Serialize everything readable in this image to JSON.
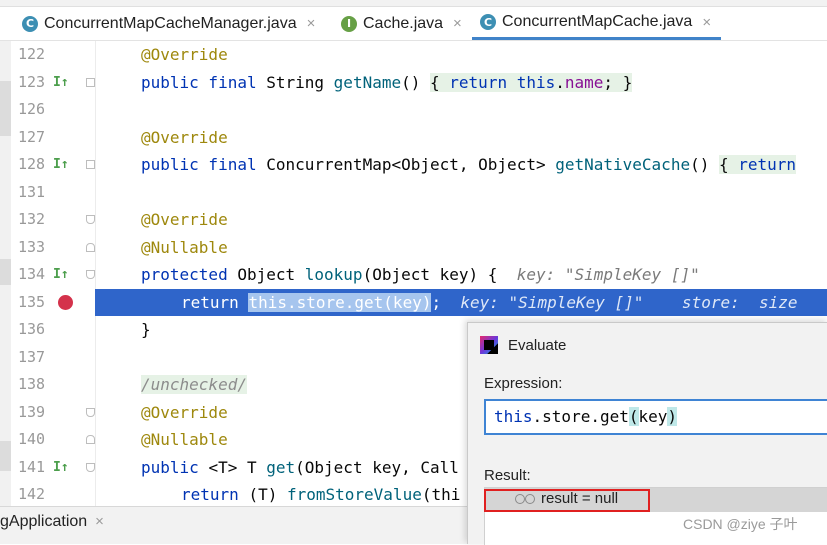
{
  "tabs": [
    {
      "label": "ConcurrentMapCacheManager.java",
      "icon": "C",
      "close": "×"
    },
    {
      "label": "Cache.java",
      "icon": "I",
      "close": "×"
    },
    {
      "label": "ConcurrentMapCache.java",
      "icon": "C",
      "close": "×",
      "active": true
    }
  ],
  "lines": {
    "l122": {
      "num": "122",
      "t1": "@Override"
    },
    "l123": {
      "num": "123",
      "t1": "public final ",
      "t2": "String ",
      "t3": "getName",
      "t4": "() ",
      "t5": "{ ",
      "t6": "return this",
      "t7": ".",
      "t8": "name",
      "t9": "; }"
    },
    "l126": {
      "num": "126"
    },
    "l127": {
      "num": "127",
      "t1": "@Override"
    },
    "l128": {
      "num": "128",
      "t1": "public final ",
      "t2": "ConcurrentMap<Object, Object> ",
      "t3": "getNativeCache",
      "t4": "() ",
      "t5": "{ ",
      "t6": "return"
    },
    "l131": {
      "num": "131"
    },
    "l132": {
      "num": "132",
      "t1": "@Override"
    },
    "l133": {
      "num": "133",
      "t1": "@Nullable"
    },
    "l134": {
      "num": "134",
      "t1": "protected ",
      "t2": "Object ",
      "t3": "lookup",
      "t4": "(Object key) {",
      "hint": "key: \"SimpleKey []\""
    },
    "l135": {
      "num": "135",
      "t1": "return ",
      "sel": "this.store.get(key)",
      "t2": ";",
      "hint": "key: \"SimpleKey []\"    store:  size"
    },
    "l136": {
      "num": "136",
      "t1": "}"
    },
    "l137": {
      "num": "137"
    },
    "l138": {
      "num": "138",
      "t1": "/unchecked/"
    },
    "l139": {
      "num": "139",
      "t1": "@Override"
    },
    "l140": {
      "num": "140",
      "t1": "@Nullable"
    },
    "l141": {
      "num": "141",
      "t1": "public ",
      "t2": "<T> T ",
      "t3": "get",
      "t4": "(Object key, Call"
    },
    "l142": {
      "num": "142",
      "t1": "return ",
      "t2": "(T) ",
      "t3": "fromStoreValue",
      "t4": "(thi"
    }
  },
  "bottom_tab": {
    "label": "gApplication",
    "close": "×"
  },
  "evaluate": {
    "title": "Evaluate",
    "expression_label": "Expression:",
    "expr_a": "this",
    "expr_b": ".store.get",
    "expr_c": "(",
    "expr_d": "key",
    "expr_e": ")",
    "result_label": "Result:",
    "result_text": "result = null"
  },
  "watermark": "CSDN @ziye 子叶",
  "colors": {
    "keyword": "#0033b3",
    "annotation": "#9e880d",
    "method": "#00627a",
    "field": "#871094",
    "current_line": "#2f65ca",
    "highlight_box": "#e02020"
  }
}
